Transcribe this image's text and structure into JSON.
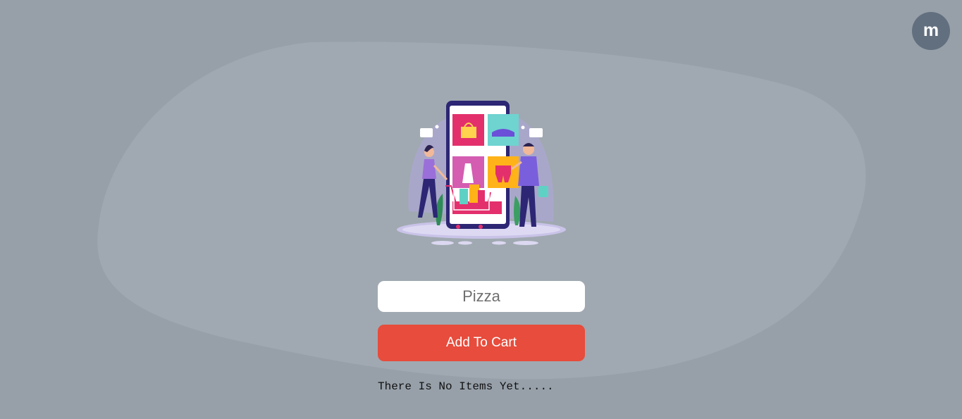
{
  "header": {
    "avatar_letter": "m"
  },
  "form": {
    "item_placeholder": "Pizza",
    "add_button_label": "Add To Cart"
  },
  "list": {
    "empty_message": "There Is No Items Yet....."
  },
  "colors": {
    "background": "#97a0a9",
    "blob": "#a0a9b1",
    "avatar": "#626f7f",
    "button": "#e74c3c"
  }
}
